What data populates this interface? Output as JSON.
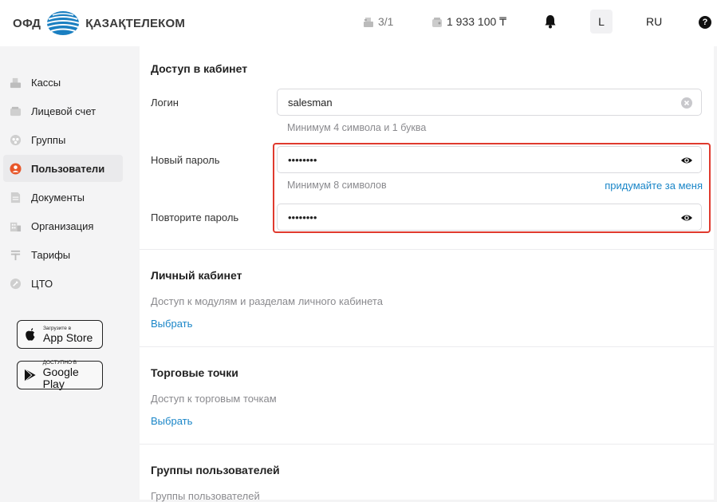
{
  "header": {
    "logo_ofd": "ОФД",
    "logo_brand": "ҚАЗАҚТЕЛЕКОМ",
    "kassa_count": "3/1",
    "balance": "1 933 100 ₸",
    "user_initial": "L",
    "language": "RU",
    "help": "?"
  },
  "sidebar": {
    "items": [
      {
        "label": "Кассы",
        "icon": "cash-register-icon"
      },
      {
        "label": "Лицевой счет",
        "icon": "wallet-icon"
      },
      {
        "label": "Группы",
        "icon": "groups-icon"
      },
      {
        "label": "Пользователи",
        "icon": "user-icon",
        "active": true
      },
      {
        "label": "Документы",
        "icon": "document-icon"
      },
      {
        "label": "Организация",
        "icon": "building-icon"
      },
      {
        "label": "Тарифы",
        "icon": "tenge-icon"
      },
      {
        "label": "ЦТО",
        "icon": "service-icon"
      }
    ],
    "app_store": {
      "small": "Загрузите в",
      "big": "App Store"
    },
    "google_play": {
      "small": "ДОСТУПНО В",
      "big": "Google Play"
    }
  },
  "form": {
    "access_title": "Доступ в кабинет",
    "login_label": "Логин",
    "login_value": "salesman",
    "login_hint": "Минимум 4 символа и 1 буква",
    "new_password_label": "Новый пароль",
    "new_password_value": "••••••••",
    "password_hint": "Минимум 8 символов",
    "generate_link": "придумайте за меня",
    "repeat_password_label": "Повторите пароль",
    "repeat_password_value": "••••••••",
    "cabinet_title": "Личный кабинет",
    "cabinet_desc": "Доступ к модулям и разделам личного кабинета",
    "cabinet_select": "Выбрать",
    "points_title": "Торговые точки",
    "points_desc": "Доступ к торговым точкам",
    "points_select": "Выбрать",
    "groups_title": "Группы пользователей",
    "groups_desc": "Группы пользователей"
  },
  "colors": {
    "accent_link": "#1a86c8",
    "active_icon": "#e8572a",
    "highlight_border": "#e03a2e",
    "brand_blue": "#1a7fc1"
  }
}
